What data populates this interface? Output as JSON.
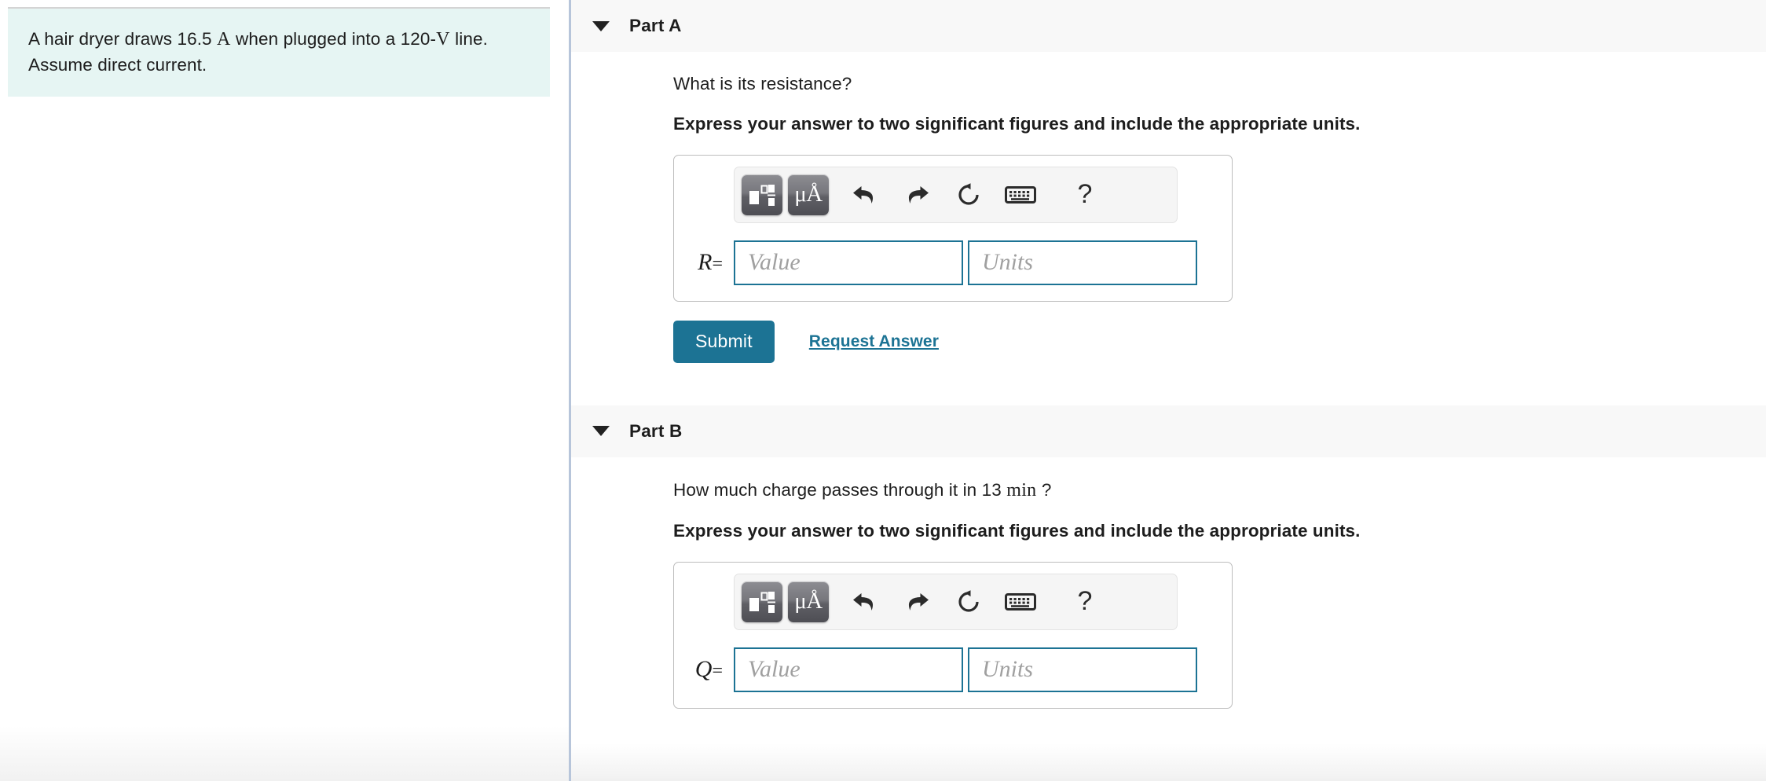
{
  "problem": {
    "text_before_current": "A hair dryer draws 16.5",
    "current_unit": "A",
    "text_middle": "when plugged into a 120-",
    "voltage_unit": "V",
    "text_after": "line. Assume direct current."
  },
  "toolbar": {
    "template_button_name": "math-template",
    "units_button_label": "μÅ",
    "undo_label": "undo",
    "redo_label": "redo",
    "reset_label": "reset",
    "keyboard_label": "keyboard",
    "help_label": "?"
  },
  "parts": [
    {
      "id": "A",
      "title": "Part A",
      "question": "What is its resistance?",
      "instruction": "Express your answer to two significant figures and include the appropriate units.",
      "variable": "R",
      "equals": "=",
      "value_placeholder": "Value",
      "units_placeholder": "Units",
      "value": "",
      "units": "",
      "submit_label": "Submit",
      "request_answer_label": "Request Answer"
    },
    {
      "id": "B",
      "title": "Part B",
      "question_before": "How much charge passes through it in 13",
      "question_unit": "min",
      "question_after": "?",
      "instruction": "Express your answer to two significant figures and include the appropriate units.",
      "variable": "Q",
      "equals": "=",
      "value_placeholder": "Value",
      "units_placeholder": "Units",
      "value": "",
      "units": ""
    }
  ],
  "colors": {
    "accent": "#1c7394",
    "problem_background": "#e6f5f3",
    "header_background": "#f8f8f8",
    "divider": "#b7c5da",
    "input_border": "#1c7394"
  }
}
